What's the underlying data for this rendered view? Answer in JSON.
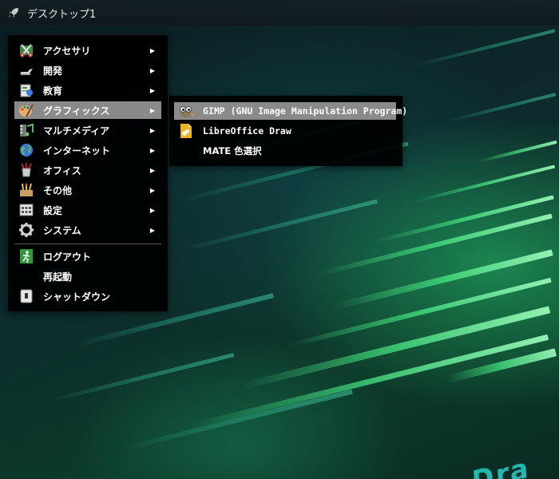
{
  "panel": {
    "title": "デスクトップ1",
    "launcher_icon": "rocket-icon"
  },
  "menu": {
    "items": [
      {
        "label": "アクセサリ",
        "icon": "accessories-icon",
        "submenu": true
      },
      {
        "label": "開発",
        "icon": "development-icon",
        "submenu": true
      },
      {
        "label": "教育",
        "icon": "education-icon",
        "submenu": true
      },
      {
        "label": "グラフィックス",
        "icon": "graphics-icon",
        "submenu": true,
        "active": true
      },
      {
        "label": "マルチメディア",
        "icon": "multimedia-icon",
        "submenu": true
      },
      {
        "label": "インターネット",
        "icon": "internet-globe-icon",
        "submenu": true
      },
      {
        "label": "オフィス",
        "icon": "office-icon",
        "submenu": true
      },
      {
        "label": "その他",
        "icon": "other-icon",
        "submenu": true
      },
      {
        "label": "設定",
        "icon": "settings-icon",
        "submenu": true
      },
      {
        "label": "システム",
        "icon": "system-gear-icon",
        "submenu": true
      }
    ],
    "actions": [
      {
        "label": "ログアウト",
        "icon": "logout-icon"
      },
      {
        "label": "再起動",
        "icon": ""
      },
      {
        "label": "シャットダウン",
        "icon": "shutdown-icon"
      }
    ],
    "arrow_glyph": "▶"
  },
  "submenu": {
    "items": [
      {
        "label": "GIMP (GNU Image Manipulation Program)",
        "icon": "gimp-icon",
        "active": true
      },
      {
        "label": "LibreOffice Draw",
        "icon": "libreoffice-draw-icon"
      },
      {
        "label": "MATE 色選択",
        "icon": ""
      }
    ]
  },
  "colors": {
    "menu_bg": "#000000",
    "active_bg": "#8a8a8a",
    "wallpaper_accent": "#3ddc84"
  }
}
